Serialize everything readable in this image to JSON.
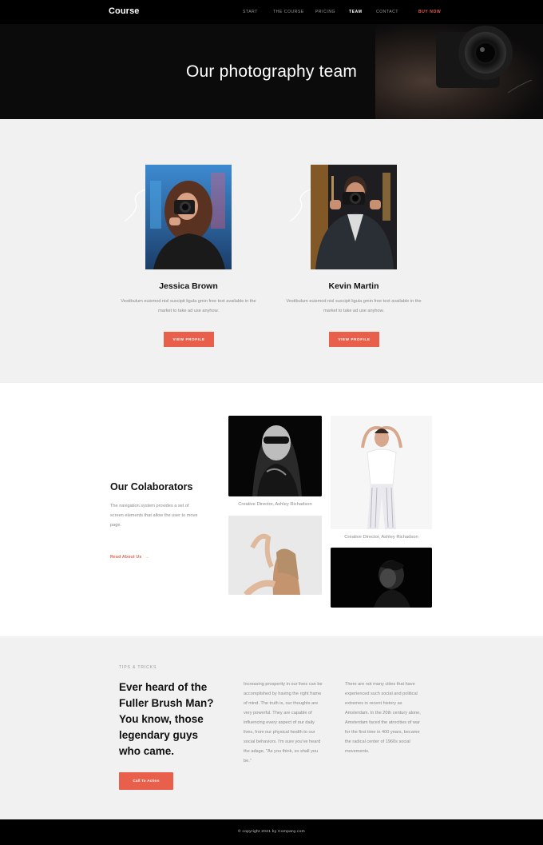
{
  "nav": {
    "logo": "Course",
    "items": [
      {
        "label": "START"
      },
      {
        "label": "THE COURSE"
      },
      {
        "label": "PRICING"
      },
      {
        "label": "TEAM"
      },
      {
        "label": "CONTACT"
      },
      {
        "label": "BUY NOW"
      }
    ],
    "active_index": 3
  },
  "hero": {
    "title": "Our photography team"
  },
  "team": {
    "members": [
      {
        "name": "Jessica Brown",
        "description": "Vestibulum euismod nisl suscipit ligula gmin free text available in the market to take ad use anyhow.",
        "button": "VIEW PROFILE"
      },
      {
        "name": "Kevin Martin",
        "description": "Vestibulum euismod nisl suscipit ligula gmin free text available in the market to take ad use anyhow.",
        "button": "VIEW PROFILE"
      }
    ]
  },
  "collaborators": {
    "title": "Our Colaborators",
    "description": "The navigation system provides a set of screen elements that allow the user to move page.",
    "link": "Read About Us",
    "captions": [
      "Creative Director, Ashley Richadson",
      "Creative Director, Ashley Richadson"
    ]
  },
  "tips": {
    "eyebrow": "TIPS & TRICKS",
    "heading": "Ever heard of the Fuller Brush Man? You know, those legendary guys who came.",
    "col1": "Increasing prosperity in our lives can be accomplished by having the right frame of mind. The truth is, our thoughts are very powerful. They are capable of influencing every aspect of our daily lives, from our physical health to our social behaviors. I'm sure you've heard the adage, \"As you think, so shall you be.\"",
    "col2": "There are not many cities that have experienced such social and political extremes in recent history as Amsterdam. In the 20th century alone, Amsterdam faced the atrocities of war for the first time in 400 years, became the radical center of 1960s social movements.",
    "button": "Call To Action"
  },
  "footer": {
    "text": "© copyright 2021 by Company.com"
  },
  "colors": {
    "accent": "#e8604c",
    "dark": "#000000",
    "light_bg": "#f1f1f1"
  }
}
